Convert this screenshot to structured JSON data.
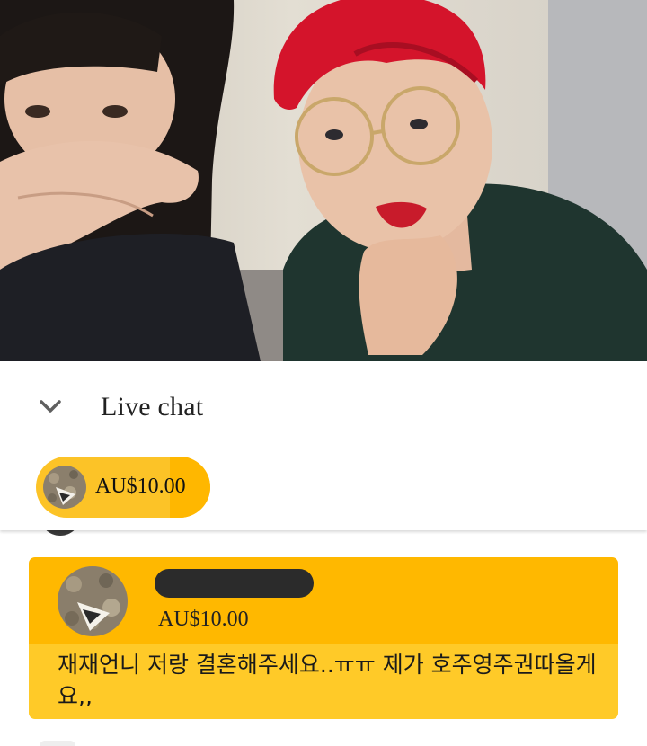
{
  "chat_header": {
    "collapse_icon": "chevron-down-icon",
    "title": "Live chat"
  },
  "ticker": {
    "amount": "AU$10.00",
    "accent": "#fcc327",
    "progress": 0.23
  },
  "superchat": {
    "amount": "AU$10.00",
    "name_redacted": true,
    "message": "재재언니 저랑 결혼해주세요..ㅠㅠ 제가 호주영주권따올게요,,",
    "header_color": "#ffb800",
    "body_color": "#ffca28"
  }
}
